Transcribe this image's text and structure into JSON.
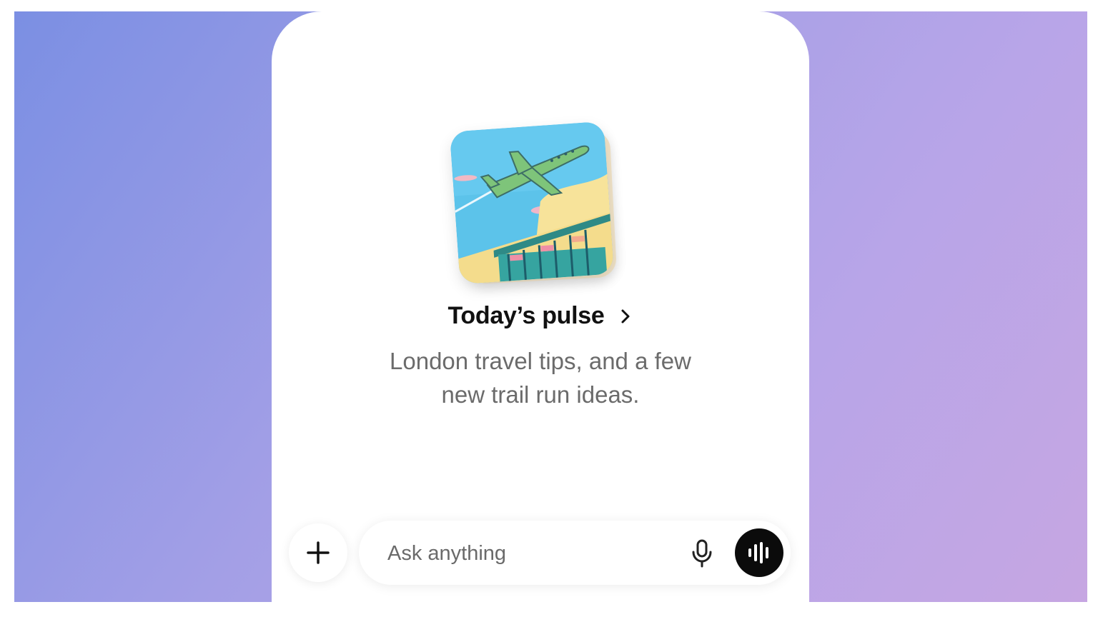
{
  "pulse": {
    "title": "Today’s pulse",
    "subtitle_line1": "London travel tips, and a few",
    "subtitle_line2": "new trail run ideas.",
    "image_icon": "airplane-illustration-icon",
    "chevron_icon": "chevron-right-icon"
  },
  "composer": {
    "placeholder": "Ask anything",
    "value": "",
    "add_icon": "plus-icon",
    "mic_icon": "microphone-icon",
    "voice_icon": "voice-waveform-icon"
  },
  "colors": {
    "background_start": "#7b8fe3",
    "background_end": "#c6a6e2",
    "phone": "#ffffff",
    "title": "#111111",
    "subtitle": "#6b6b6b",
    "voice_button": "#0b0b0b"
  }
}
